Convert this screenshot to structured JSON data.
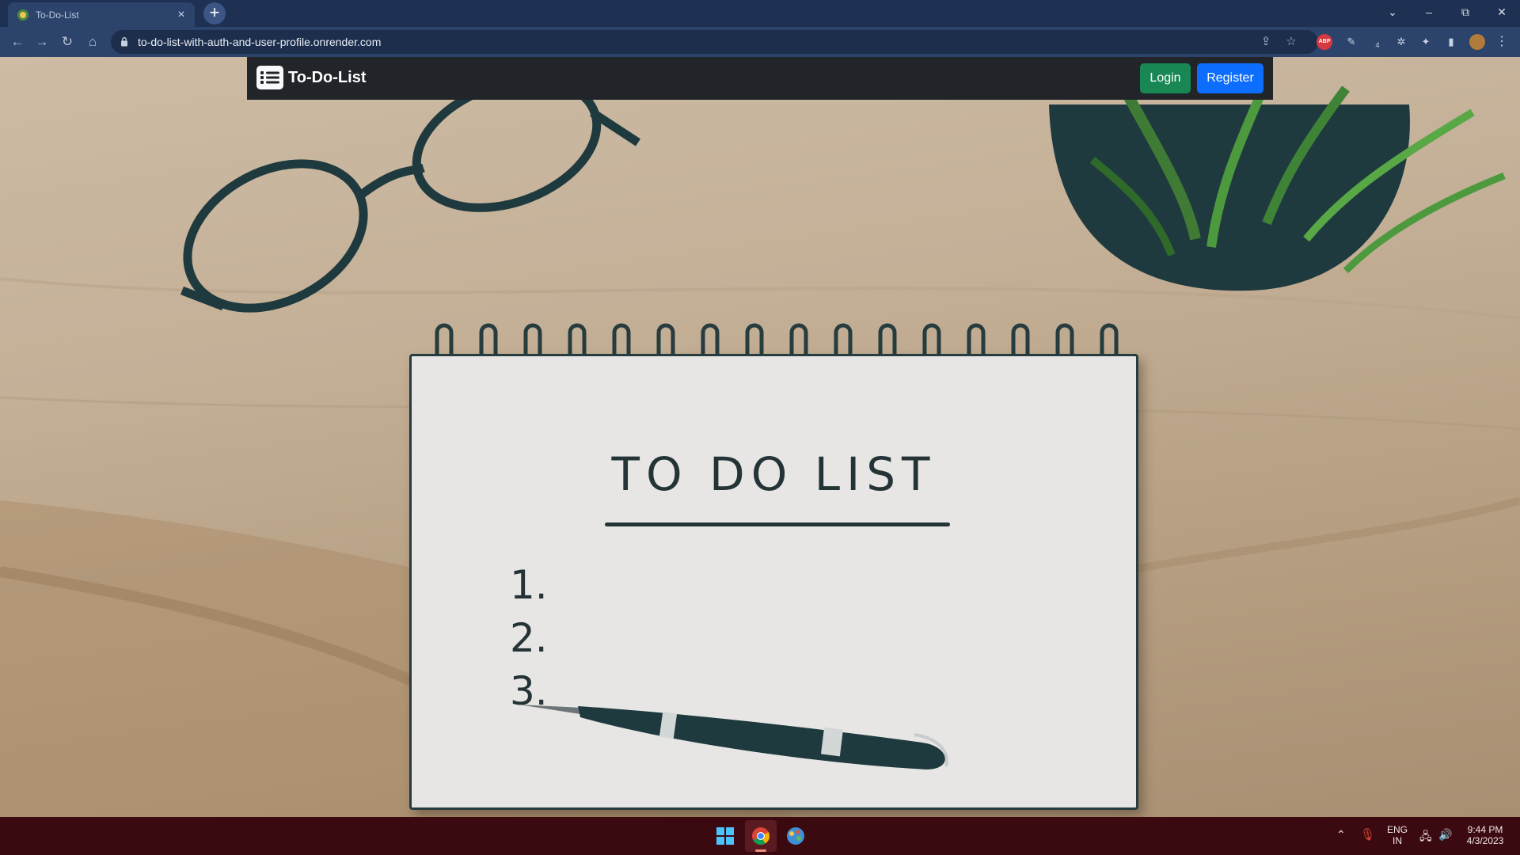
{
  "browser": {
    "tab_title": "To-Do-List",
    "new_tab_label": "+",
    "url": "to-do-list-with-auth-and-user-profile.onrender.com",
    "window_controls": [
      "⌄",
      "–",
      "⧉",
      "✕"
    ],
    "extensions": [
      {
        "name": "adblock-plus-icon",
        "label": "ABP"
      },
      {
        "name": "pin-extension-icon",
        "label": "✎"
      },
      {
        "name": "tab-counter-extension-icon",
        "label": "4"
      },
      {
        "name": "bug-extension-icon",
        "label": "✲"
      },
      {
        "name": "puzzle-extensions-icon",
        "label": "✦"
      },
      {
        "name": "side-panel-icon",
        "label": "▮"
      },
      {
        "name": "profile-avatar-icon",
        "label": ""
      },
      {
        "name": "menu-kebab-icon",
        "label": "⋮"
      }
    ]
  },
  "page": {
    "brand": "To-Do-List",
    "login_label": "Login",
    "register_label": "Register",
    "hero": {
      "title": "TO DO LIST",
      "items": [
        "1.",
        "2.",
        "3."
      ]
    },
    "colors": {
      "navbar": "#212529",
      "login": "#198754",
      "register": "#0d6efd"
    }
  },
  "taskbar": {
    "language": "ENG",
    "region": "IN",
    "time": "9:44 PM",
    "date": "4/3/2023"
  }
}
